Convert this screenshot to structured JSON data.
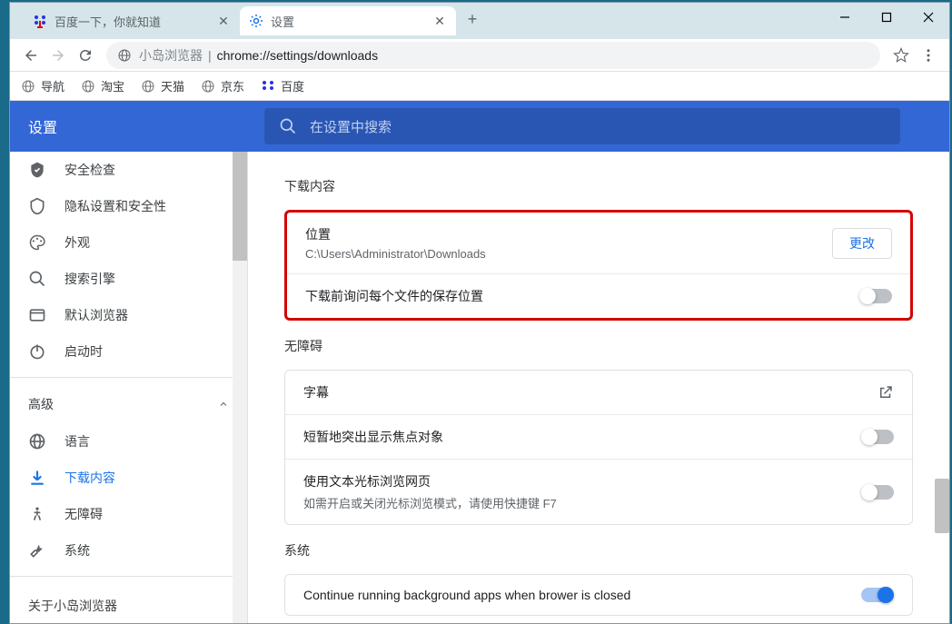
{
  "tabs": [
    {
      "title": "百度一下，你就知道",
      "favicon": "baidu"
    },
    {
      "title": "设置",
      "favicon": "gear"
    }
  ],
  "addressbar": {
    "label": "小岛浏览器",
    "url": "chrome://settings/downloads"
  },
  "bookmarks": [
    {
      "label": "导航",
      "icon": "globe"
    },
    {
      "label": "淘宝",
      "icon": "globe"
    },
    {
      "label": "天猫",
      "icon": "globe"
    },
    {
      "label": "京东",
      "icon": "globe"
    },
    {
      "label": "百度",
      "icon": "baidu"
    }
  ],
  "settings_header": {
    "title": "设置",
    "search_placeholder": "在设置中搜索"
  },
  "sidebar": {
    "items": [
      {
        "label": "安全检查",
        "icon": "shield-check"
      },
      {
        "label": "隐私设置和安全性",
        "icon": "shield"
      },
      {
        "label": "外观",
        "icon": "palette"
      },
      {
        "label": "搜索引擎",
        "icon": "search"
      },
      {
        "label": "默认浏览器",
        "icon": "browser"
      },
      {
        "label": "启动时",
        "icon": "power"
      }
    ],
    "advanced_label": "高级",
    "advanced_items": [
      {
        "label": "语言",
        "icon": "globe-web"
      },
      {
        "label": "下载内容",
        "icon": "download",
        "active": true
      },
      {
        "label": "无障碍",
        "icon": "accessibility"
      },
      {
        "label": "系统",
        "icon": "wrench"
      }
    ],
    "about_label": "关于小岛浏览器"
  },
  "main": {
    "downloads": {
      "title": "下载内容",
      "location_label": "位置",
      "location_value": "C:\\Users\\Administrator\\Downloads",
      "change_label": "更改",
      "ask_label": "下载前询问每个文件的保存位置"
    },
    "accessibility": {
      "title": "无障碍",
      "captions_label": "字幕",
      "highlight_label": "短暂地突出显示焦点对象",
      "caret_label": "使用文本光标浏览网页",
      "caret_sub": "如需开启或关闭光标浏览模式，请使用快捷键 F7"
    },
    "system": {
      "title": "系统",
      "continue_label": "Continue running background apps when brower is closed"
    }
  }
}
